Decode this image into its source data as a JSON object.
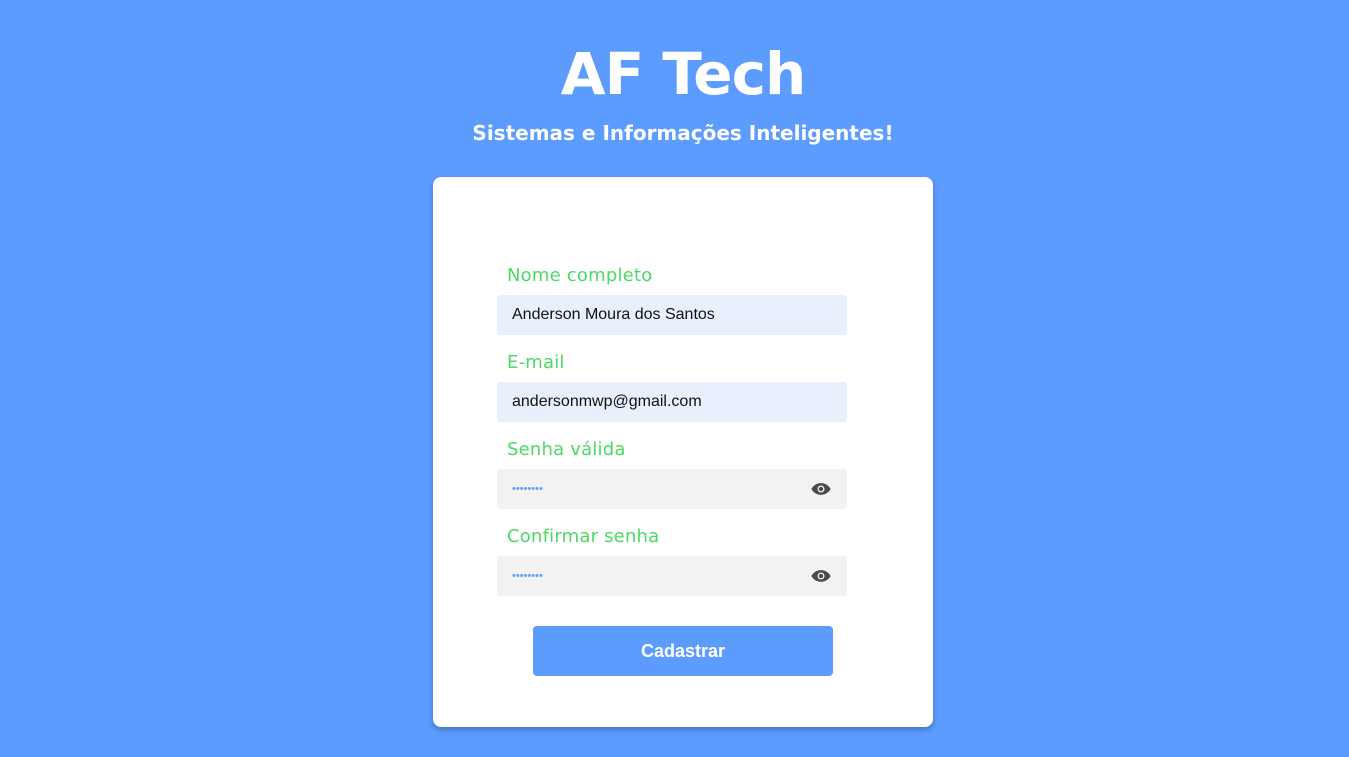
{
  "header": {
    "title": "AF Tech",
    "subtitle": "Sistemas e Informações Inteligentes!"
  },
  "form": {
    "full_name": {
      "label": "Nome completo",
      "value": "Anderson Moura dos Santos"
    },
    "email": {
      "label": "E-mail",
      "value": "andersonmwp@gmail.com"
    },
    "password": {
      "label": "Senha válida",
      "masked_value": "••••••••",
      "toggle_icon": "eye-icon"
    },
    "confirm_password": {
      "label": "Confirmar senha",
      "masked_value": "••••••••",
      "toggle_icon": "eye-icon"
    },
    "submit_label": "Cadastrar"
  },
  "colors": {
    "background": "#5c9cff",
    "label": "#4cd964",
    "button": "#5c9cff",
    "autofill_field": "#e8f0fe",
    "password_field": "#f2f2f2"
  }
}
